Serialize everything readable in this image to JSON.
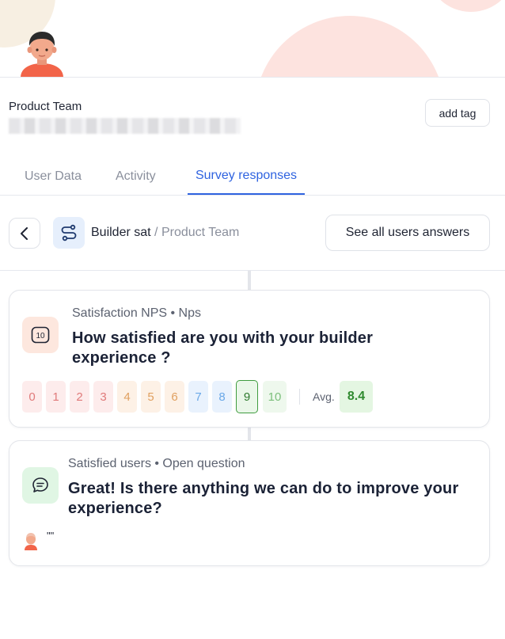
{
  "profile": {
    "name": "Product Team",
    "add_tag_label": "add tag"
  },
  "tabs": [
    {
      "label": "User Data",
      "active": false
    },
    {
      "label": "Activity",
      "active": false
    },
    {
      "label": "Survey responses",
      "active": true
    }
  ],
  "survey_bar": {
    "survey_name": "Builder sat",
    "separator": "/",
    "team": "Product Team",
    "see_all_label": "See all users answers"
  },
  "questions": [
    {
      "icon": "nps-10-icon",
      "meta": "Satisfaction NPS • Nps",
      "title": "How satisfied are you with your builder experience ?",
      "scale": [
        {
          "label": "0",
          "color": "#e07a7a",
          "bg": "#fdecec"
        },
        {
          "label": "1",
          "color": "#e07a7a",
          "bg": "#fdecec"
        },
        {
          "label": "2",
          "color": "#e07a7a",
          "bg": "#fdecec"
        },
        {
          "label": "3",
          "color": "#e07a7a",
          "bg": "#fdecec"
        },
        {
          "label": "4",
          "color": "#e0a060",
          "bg": "#fdf1e6"
        },
        {
          "label": "5",
          "color": "#e0a060",
          "bg": "#fdf1e6"
        },
        {
          "label": "6",
          "color": "#e0a060",
          "bg": "#fdf1e6"
        },
        {
          "label": "7",
          "color": "#6aa8e8",
          "bg": "#e9f2fd"
        },
        {
          "label": "8",
          "color": "#6aa8e8",
          "bg": "#e9f2fd"
        },
        {
          "label": "9",
          "color": "#2f7a2f",
          "bg": "#eaf7e9"
        },
        {
          "label": "10",
          "color": "#7cbf7c",
          "bg": "#eef8ed"
        }
      ],
      "selected": "9",
      "avg_label": "Avg.",
      "avg_value": "8.4"
    },
    {
      "icon": "chat-bubble-icon",
      "meta": "Satisfied users • Open question",
      "title": "Great! Is there anything we can do to improve your experience?",
      "answer": "\"\""
    }
  ],
  "colors": {
    "accent": "#2f63e0",
    "selected_green": "#3f9c3f",
    "avg_bg": "#e4f6e2"
  }
}
